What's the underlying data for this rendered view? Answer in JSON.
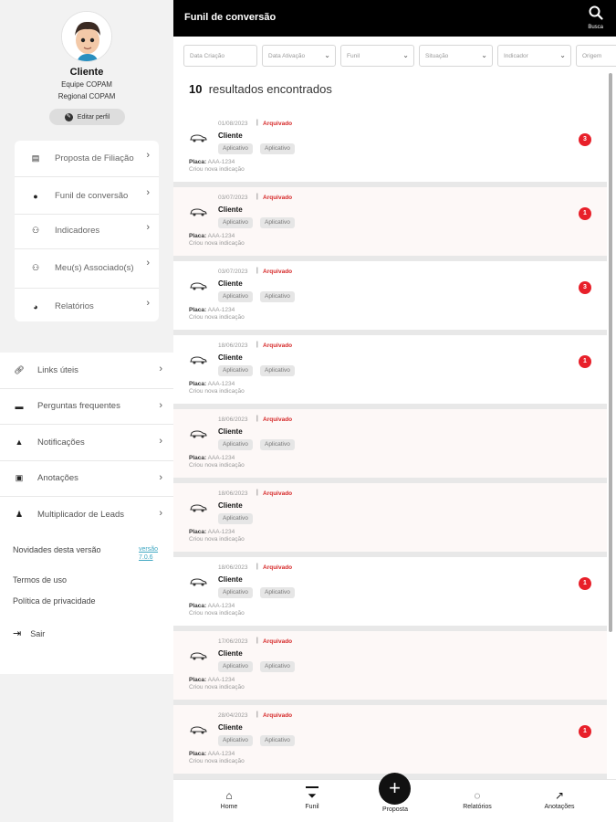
{
  "sidebar": {
    "profile": {
      "name": "Cliente",
      "team": "Equipe COPAM",
      "region": "Regional COPAM",
      "edit_label": "Editar perfil"
    },
    "menu_primary": [
      {
        "label": "Proposta de Filiação",
        "icon": "document-icon"
      },
      {
        "label": "Funil de conversão",
        "icon": "location-pin-icon"
      },
      {
        "label": "Indicadores",
        "icon": "group-icon"
      },
      {
        "label": "Meu(s) Associado(s)",
        "icon": "group-icon"
      },
      {
        "label": "Relatórios",
        "icon": "pie-chart-icon"
      }
    ],
    "menu_secondary": [
      {
        "label": "Links úteis",
        "icon": "link-icon"
      },
      {
        "label": "Perguntas frequentes",
        "icon": "chat-icon"
      },
      {
        "label": "Notificações",
        "icon": "bell-icon"
      },
      {
        "label": "Anotações",
        "icon": "image-icon"
      },
      {
        "label": "Multiplicador de Leads",
        "icon": "user-add-icon"
      }
    ],
    "novidades": "Novidades desta versão",
    "versao_link": "versão 7.0.6",
    "termos": "Termos de uso",
    "politica": "Política de privacidade",
    "sair": "Sair"
  },
  "header": {
    "title": "Funil de conversão",
    "search_label": "Busca"
  },
  "filters": [
    {
      "placeholder": "Data Criação",
      "dropdown": false
    },
    {
      "placeholder": "Data Ativação",
      "dropdown": true
    },
    {
      "placeholder": "Funil",
      "dropdown": true
    },
    {
      "placeholder": "Situação",
      "dropdown": true
    },
    {
      "placeholder": "Indicador",
      "dropdown": true
    },
    {
      "placeholder": "Origem",
      "dropdown": false
    }
  ],
  "results": {
    "count": "10",
    "label": "resultados encontrados"
  },
  "cards": [
    {
      "date": "01/08/2023",
      "status": "Arquivado",
      "name": "Cliente",
      "tags": [
        "Aplicativo",
        "Aplicativo"
      ],
      "placa_label": "Placa:",
      "placa": "AAA-1234",
      "criou": "Criou nova indicação",
      "badge": "3",
      "alt": false
    },
    {
      "date": "03/07/2023",
      "status": "Arquivado",
      "name": "Cliente",
      "tags": [
        "Aplicativo",
        "Aplicativo"
      ],
      "placa_label": "Placa:",
      "placa": "AAA-1234",
      "criou": "Criou nova indicação",
      "badge": "1",
      "alt": true
    },
    {
      "date": "03/07/2023",
      "status": "Arquivado",
      "name": "Cliente",
      "tags": [
        "Aplicativo",
        "Aplicativo"
      ],
      "placa_label": "Placa:",
      "placa": "AAA-1234",
      "criou": "Criou nova indicação",
      "badge": "3",
      "alt": false
    },
    {
      "date": "18/06/2023",
      "status": "Arquivado",
      "name": "Cliente",
      "tags": [
        "Aplicativo",
        "Aplicativo"
      ],
      "placa_label": "Placa:",
      "placa": "AAA-1234",
      "criou": "Criou nova indicação",
      "badge": "1",
      "alt": false
    },
    {
      "date": "18/06/2023",
      "status": "Arquivado",
      "name": "Cliente",
      "tags": [
        "Aplicativo",
        "Aplicativo"
      ],
      "placa_label": "Placa:",
      "placa": "AAA-1234",
      "criou": "Criou nova indicação",
      "badge": "",
      "alt": true
    },
    {
      "date": "18/06/2023",
      "status": "Arquivado",
      "name": "Cliente",
      "tags": [
        "Aplicativo"
      ],
      "placa_label": "Placa:",
      "placa": "AAA-1234",
      "criou": "Criou nova indicação",
      "badge": "",
      "alt": true
    },
    {
      "date": "18/06/2023",
      "status": "Arquivado",
      "name": "Cliente",
      "tags": [
        "Aplicativo",
        "Aplicativo"
      ],
      "placa_label": "Placa:",
      "placa": "AAA-1234",
      "criou": "Criou nova indicação",
      "badge": "1",
      "alt": false
    },
    {
      "date": "17/06/2023",
      "status": "Arquivado",
      "name": "Cliente",
      "tags": [
        "Aplicativo",
        "Aplicativo"
      ],
      "placa_label": "Placa:",
      "placa": "AAA-1234",
      "criou": "Criou nova indicação",
      "badge": "",
      "alt": true
    },
    {
      "date": "28/04/2023",
      "status": "Arquivado",
      "name": "Cliente",
      "tags": [
        "Aplicativo",
        "Aplicativo"
      ],
      "placa_label": "Placa:",
      "placa": "AAA-1234",
      "criou": "Criou nova indicação",
      "badge": "1",
      "alt": true
    }
  ],
  "bottom_nav": {
    "home": "Home",
    "funil": "Funil",
    "proposta": "Proposta",
    "relatorios": "Relatórios",
    "anotacoes": "Anotações"
  },
  "colors": {
    "status": "#d62a2a",
    "badge": "#e8202a",
    "topbar": "#000000"
  }
}
